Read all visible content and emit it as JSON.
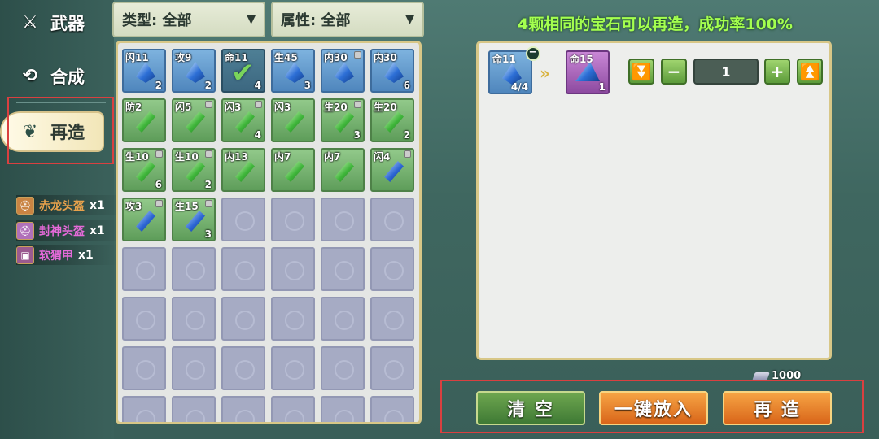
{
  "nav": {
    "items": [
      {
        "label": "武器",
        "icon": "weapon-icon"
      },
      {
        "label": "合成",
        "icon": "synthesis-icon"
      },
      {
        "label": "再造",
        "icon": "reforge-icon",
        "active": true
      }
    ]
  },
  "rewards": [
    {
      "name": "赤龙头盔",
      "count": "x1",
      "color": "#e8a24c"
    },
    {
      "name": "封神头盔",
      "count": "x1",
      "color": "#e56ad9"
    },
    {
      "name": "软猬甲",
      "count": "x1",
      "color": "#e56ad9"
    }
  ],
  "filters": {
    "type_label": "类型: 全部",
    "attr_label": "属性: 全部"
  },
  "inventory": {
    "rows": [
      [
        {
          "t": "闪11",
          "n": "2",
          "c": "blue",
          "g": "b"
        },
        {
          "t": "攻9",
          "n": "2",
          "c": "blue",
          "g": "b"
        },
        {
          "t": "命11",
          "n": "4",
          "c": "selected",
          "g": "check"
        },
        {
          "t": "生45",
          "n": "3",
          "c": "blue",
          "g": "b"
        },
        {
          "t": "内30",
          "n": "",
          "c": "blue",
          "g": "b",
          "lock": true
        },
        {
          "t": "内30",
          "n": "6",
          "c": "blue",
          "g": "b"
        }
      ],
      [
        {
          "t": "防2",
          "n": "",
          "c": "green",
          "g": "g"
        },
        {
          "t": "闪5",
          "n": "",
          "c": "green",
          "g": "g",
          "lock": true
        },
        {
          "t": "闪3",
          "n": "4",
          "c": "green",
          "g": "g",
          "lock": true
        },
        {
          "t": "闪3",
          "n": "",
          "c": "green",
          "g": "g"
        },
        {
          "t": "生20",
          "n": "3",
          "c": "green",
          "g": "g",
          "lock": true
        },
        {
          "t": "生20",
          "n": "2",
          "c": "green",
          "g": "g"
        }
      ],
      [
        {
          "t": "生10",
          "n": "6",
          "c": "green",
          "g": "g",
          "lock": true
        },
        {
          "t": "生10",
          "n": "2",
          "c": "green",
          "g": "g",
          "lock": true
        },
        {
          "t": "内13",
          "n": "",
          "c": "green",
          "g": "g"
        },
        {
          "t": "内7",
          "n": "",
          "c": "green",
          "g": "g"
        },
        {
          "t": "内7",
          "n": "",
          "c": "green",
          "g": "g"
        },
        {
          "t": "闪4",
          "n": "",
          "c": "green",
          "g": "bd",
          "lock": true
        }
      ],
      [
        {
          "t": "攻3",
          "n": "",
          "c": "green",
          "g": "bd",
          "lock": true
        },
        {
          "t": "生15",
          "n": "3",
          "c": "green",
          "g": "bd",
          "lock": true
        }
      ]
    ]
  },
  "forge": {
    "title": "4颗相同的宝石可以再造，成功率100%",
    "input": {
      "label": "命11",
      "count": "4/4"
    },
    "output": {
      "label": "命15",
      "count": "1"
    },
    "quantity": "1",
    "min_icon": "chevron-down-bar-icon",
    "max_icon": "chevron-up-bar-icon"
  },
  "currency": {
    "amount": "1000"
  },
  "buttons": {
    "clear": "清 空",
    "auto_place": "一键放入",
    "reforge": "再 造"
  }
}
